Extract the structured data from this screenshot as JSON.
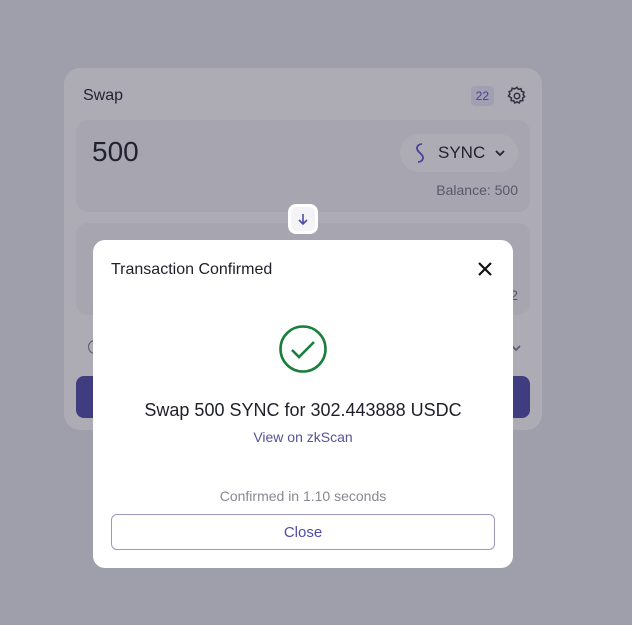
{
  "swap": {
    "title": "Swap",
    "badge": "22",
    "from": {
      "amount": "500",
      "token": "SYNC",
      "balance": "Balance: 500"
    },
    "to": {
      "balance_partial": "2"
    }
  },
  "modal": {
    "title": "Transaction Confirmed",
    "summary": "Swap 500 SYNC for 302.443888 USDC",
    "link": "View on zkScan",
    "confirmed": "Confirmed in 1.10 seconds",
    "close_label": "Close",
    "success_color": "#1a7f3c"
  },
  "colors": {
    "accent": "#4e4ba8",
    "background": "#e9e8ef"
  },
  "icons": [
    "gear-icon",
    "sync-token-icon",
    "chevron-down-icon",
    "arrow-down-icon",
    "close-icon",
    "check-circle-icon"
  ]
}
